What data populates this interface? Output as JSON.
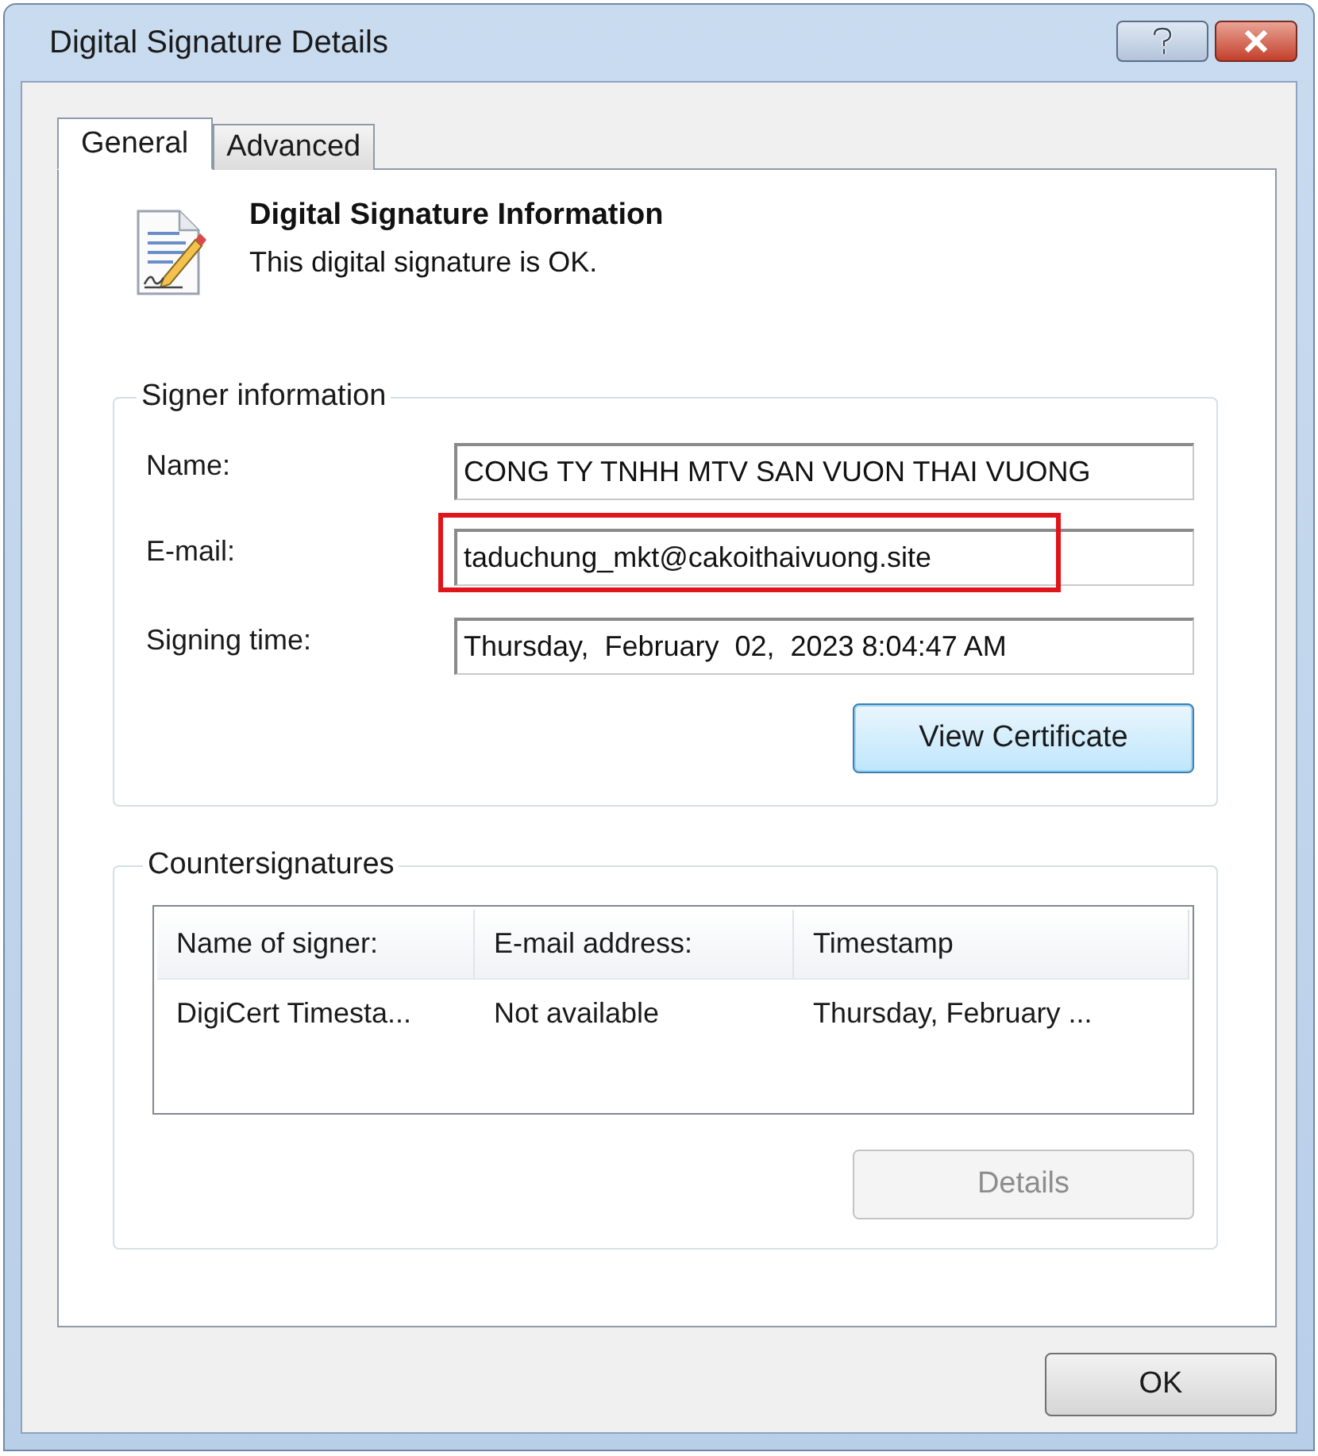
{
  "window": {
    "title": "Digital Signature Details"
  },
  "tabs": [
    {
      "label": "General",
      "selected": true
    },
    {
      "label": "Advanced",
      "selected": false
    }
  ],
  "header": {
    "title": "Digital Signature Information",
    "status": "This digital signature is OK."
  },
  "signer_information": {
    "title": "Signer information",
    "fields": [
      {
        "label": "Name:",
        "value": "CONG TY TNHH MTV SAN VUON THAI VUONG",
        "highlighted": false
      },
      {
        "label": "E-mail:",
        "value": "taduchung_mkt@cakoithaivuong.site",
        "highlighted": true
      },
      {
        "label": "Signing time:",
        "value": "Thursday,  February  02,  2023 8:04:47 AM",
        "highlighted": false
      }
    ],
    "button": {
      "label": "View Certificate",
      "disabled": false
    }
  },
  "countersignatures": {
    "title": "Countersignatures",
    "table": {
      "columns": [
        "Name of signer:",
        "E-mail address:",
        "Timestamp"
      ],
      "rows": [
        [
          "DigiCert Timesta...",
          "Not available",
          "Thursday, February ..."
        ]
      ]
    },
    "button": {
      "label": "Details",
      "disabled": true
    }
  },
  "buttons": [
    "OK"
  ]
}
